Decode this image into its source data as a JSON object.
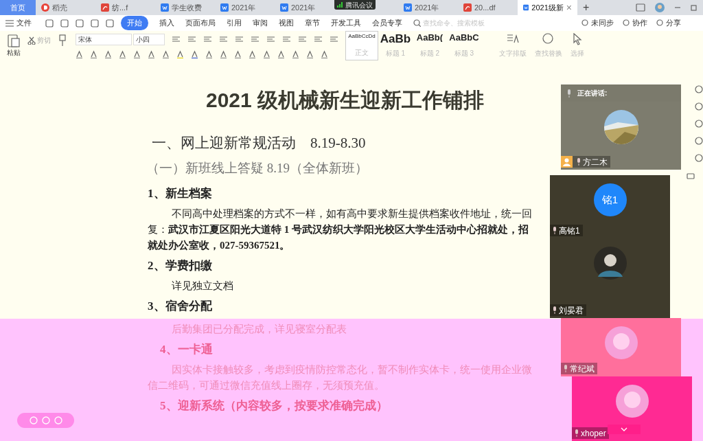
{
  "meeting_badge": "腾讯会议",
  "tabs": [
    {
      "kind": "home",
      "label": "首页",
      "selected": false
    },
    {
      "kind": "docer",
      "label": "稻壳",
      "selected": false
    },
    {
      "kind": "pdf",
      "label": "纺...f",
      "selected": false
    },
    {
      "kind": "doc",
      "label": "学生收费",
      "selected": false
    },
    {
      "kind": "doc",
      "label": "2021年",
      "selected": false
    },
    {
      "kind": "doc",
      "label": "2021年",
      "selected": false
    },
    {
      "kind": "doc",
      "label": "2021年",
      "selected": false
    },
    {
      "kind": "pdf",
      "label": "20...df",
      "selected": false
    },
    {
      "kind": "doc",
      "label": "2021级新",
      "selected": true,
      "close": "×"
    }
  ],
  "new_tab": "+",
  "menu": {
    "file": "文件",
    "items": [
      {
        "label": "开始",
        "selected": true
      },
      {
        "label": "插入",
        "selected": false
      },
      {
        "label": "页面布局",
        "selected": false
      },
      {
        "label": "引用",
        "selected": false
      },
      {
        "label": "审阅",
        "selected": false
      },
      {
        "label": "视图",
        "selected": false
      },
      {
        "label": "章节",
        "selected": false
      },
      {
        "label": "开发工具",
        "selected": false
      },
      {
        "label": "会员专享",
        "selected": false
      }
    ],
    "search_placeholder": "查找命令、搜索模板",
    "actions": [
      "未同步",
      "协作",
      "分享"
    ]
  },
  "ribbon": {
    "paste": "粘贴",
    "cut": "剪切",
    "font": "宋体",
    "size": "小四",
    "styles": [
      {
        "sample": "AaBbCcDd",
        "label": "正文",
        "selected": true
      },
      {
        "sample": "AaBb",
        "label": "标题 1",
        "selected": false
      },
      {
        "sample": "AaBb(",
        "label": "标题 2",
        "selected": false
      },
      {
        "sample": "AaBbC",
        "label": "标题 3",
        "selected": false
      }
    ],
    "tools": [
      {
        "kind": "layout",
        "label": "文字排版"
      },
      {
        "kind": "find",
        "label": "查找替换"
      },
      {
        "kind": "select",
        "label": "选择"
      }
    ]
  },
  "document": {
    "blocks": [
      {
        "kind": "title",
        "text": "2021 级机械新生迎新工作铺排",
        "tinted": false
      },
      {
        "kind": "h1",
        "text": "一、网上迎新常规活动　8.19-8.30",
        "tinted": false
      },
      {
        "kind": "h2",
        "text": "（一）新班线上答疑 8.19（全体新班）",
        "tinted": false
      },
      {
        "kind": "h3",
        "text": "1、新生档案",
        "tinted": false
      },
      {
        "kind": "para",
        "text": "不同高中处理档案的方式不一样，如有高中要求新生提供档案收件地址，统一回复：**武汉市江夏区阳光大道特 1 号武汉纺织大学阳光校区大学生活动中心招就处，招就处办公室收，027-59367521。**",
        "tinted": false
      },
      {
        "kind": "h3",
        "text": "2、学费扣缴",
        "tinted": false
      },
      {
        "kind": "para",
        "text": "详见独立文档",
        "tinted": false
      },
      {
        "kind": "h3",
        "text": "3、宿舍分配",
        "tinted": false
      },
      {
        "kind": "para",
        "text": "后勤集团已分配完成，详见寝室分配表",
        "tinted": true
      },
      {
        "kind": "h3",
        "text": "4、一卡通",
        "tinted": true
      },
      {
        "kind": "para",
        "text": "因实体卡接触较多，考虑到疫情防控常态化，暂不制作实体卡，统一使用企业微信二维码，可通过微信充值线上圈存，无须预充值。",
        "tinted": true
      },
      {
        "kind": "h3",
        "text": "5、迎新系统（内容较多，按要求准确完成）",
        "tinted": true
      }
    ]
  },
  "meeting": {
    "title": "正在讲话:",
    "participants": [
      {
        "name": "方二木",
        "host": true,
        "color": "#7d7c6e"
      },
      {
        "name": "高铭1",
        "kind": "initials",
        "initials": "铭1",
        "host": false,
        "color": "#3f3b2c"
      },
      {
        "name": "刘晏君",
        "kind": "person",
        "host": false,
        "color": "#3f3b2c"
      },
      {
        "name": "常纪斌",
        "kind": "cartoon",
        "host": false,
        "color": "#ff6f9c"
      },
      {
        "name": "xhoper",
        "kind": "cartoon",
        "host": false,
        "color": "#ff2a93"
      }
    ]
  }
}
